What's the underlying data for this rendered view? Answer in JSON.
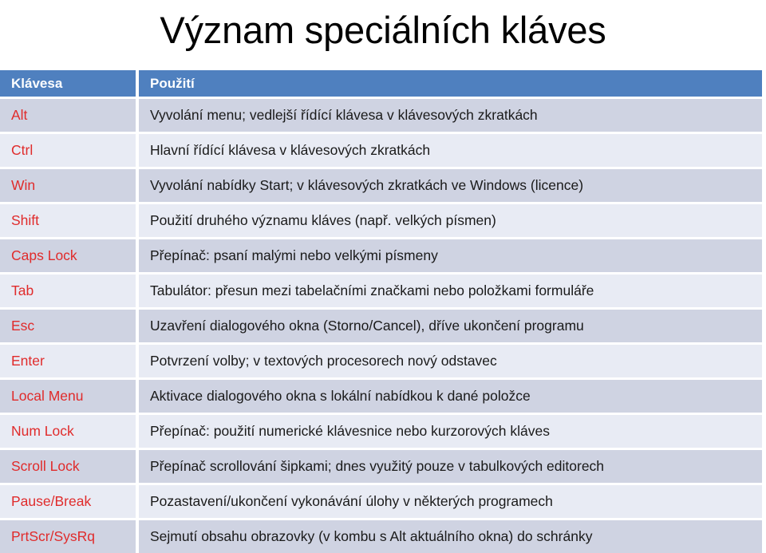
{
  "slide": {
    "title": "Význam speciálních kláves",
    "colors": {
      "header_bg": "#4F80BF",
      "header_text": "#FFFFFF",
      "band_dark": "#CFD3E2",
      "band_light": "#E8EBF4",
      "key_text": "#E02B2B",
      "body_text": "#1A1A1A",
      "page_bg": "#FFFFFF"
    }
  },
  "table": {
    "headers": {
      "key": "Klávesa",
      "usage": "Použití"
    },
    "rows": [
      {
        "key": "Alt",
        "usage": "Vyvolání menu; vedlejší řídící klávesa v klávesových zkratkách"
      },
      {
        "key": "Ctrl",
        "usage": "Hlavní řídící klávesa v klávesových zkratkách"
      },
      {
        "key": "Win",
        "usage": "Vyvolání nabídky Start; v klávesových zkratkách ve Windows (licence)"
      },
      {
        "key": "Shift",
        "usage": "Použití druhého významu kláves (např. velkých písmen)"
      },
      {
        "key": "Caps Lock",
        "usage": "Přepínač: psaní malými nebo velkými písmeny"
      },
      {
        "key": "Tab",
        "usage": "Tabulátor: přesun mezi tabelačními značkami nebo položkami formuláře"
      },
      {
        "key": "Esc",
        "usage": "Uzavření dialogového okna (Storno/Cancel), dříve ukončení programu"
      },
      {
        "key": "Enter",
        "usage": "Potvrzení volby; v textových procesorech nový odstavec"
      },
      {
        "key": "Local Menu",
        "usage": "Aktivace dialogového okna s lokální nabídkou k dané položce"
      },
      {
        "key": "Num Lock",
        "usage": "Přepínač: použití numerické klávesnice nebo kurzorových kláves"
      },
      {
        "key": "Scroll Lock",
        "usage": "Přepínač scrollování šipkami; dnes využitý pouze v tabulkových editorech"
      },
      {
        "key": "Pause/Break",
        "usage": "Pozastavení/ukončení vykonávání úlohy v některých programech"
      },
      {
        "key": "PrtScr/SysRq",
        "usage": "Sejmutí obsahu obrazovky (v kombu s Alt aktuálního okna) do schránky"
      }
    ]
  }
}
